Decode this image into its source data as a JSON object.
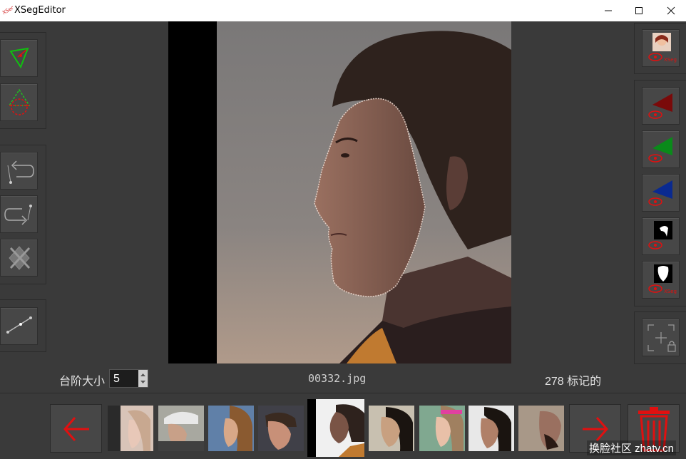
{
  "window": {
    "title": "XSegEditor",
    "controls": [
      "minimize",
      "maximize",
      "close"
    ]
  },
  "toolbar_left": [
    {
      "name": "poly-include-mode",
      "icon": "green-triangle-pen-icon"
    },
    {
      "name": "poly-exclude-mode",
      "icon": "red-dashed-triangle-icon"
    },
    {
      "name": "undo",
      "icon": "undo-point-icon"
    },
    {
      "name": "redo",
      "icon": "redo-point-icon"
    },
    {
      "name": "delete-poly",
      "icon": "delete-poly-icon"
    },
    {
      "name": "pt-edit",
      "icon": "line-edit-icon"
    }
  ],
  "toolbar_right": [
    {
      "name": "view-baked-mask",
      "icon": "face-eye-icon",
      "text": "XSeg"
    },
    {
      "name": "view-red",
      "icon": "red-triangle-eye-icon"
    },
    {
      "name": "view-green",
      "icon": "green-triangle-eye-icon"
    },
    {
      "name": "view-blue",
      "icon": "blue-triangle-eye-icon"
    },
    {
      "name": "view-mask",
      "icon": "mask-eye-icon"
    },
    {
      "name": "view-xseg-mask",
      "icon": "xseg-mask-eye-icon",
      "text": "XSeg"
    },
    {
      "name": "lock-mask",
      "icon": "add-lock-icon"
    }
  ],
  "status": {
    "step_label": "台阶大小",
    "step_value": "5",
    "filename": "00332.jpg",
    "marked_count": "278 标记的"
  },
  "thumbnails": [
    {
      "name": "thumb-1"
    },
    {
      "name": "thumb-2"
    },
    {
      "name": "thumb-3"
    },
    {
      "name": "thumb-4"
    },
    {
      "name": "thumb-current",
      "selected": true
    },
    {
      "name": "thumb-6"
    },
    {
      "name": "thumb-7"
    },
    {
      "name": "thumb-8"
    },
    {
      "name": "thumb-9"
    }
  ],
  "watermark": "换脸社区 zhatv.cn",
  "colors": {
    "accent_red": "#e01010",
    "accent_green": "#10a010",
    "accent_blue": "#0a2a90",
    "background": "#3a3a3a"
  }
}
